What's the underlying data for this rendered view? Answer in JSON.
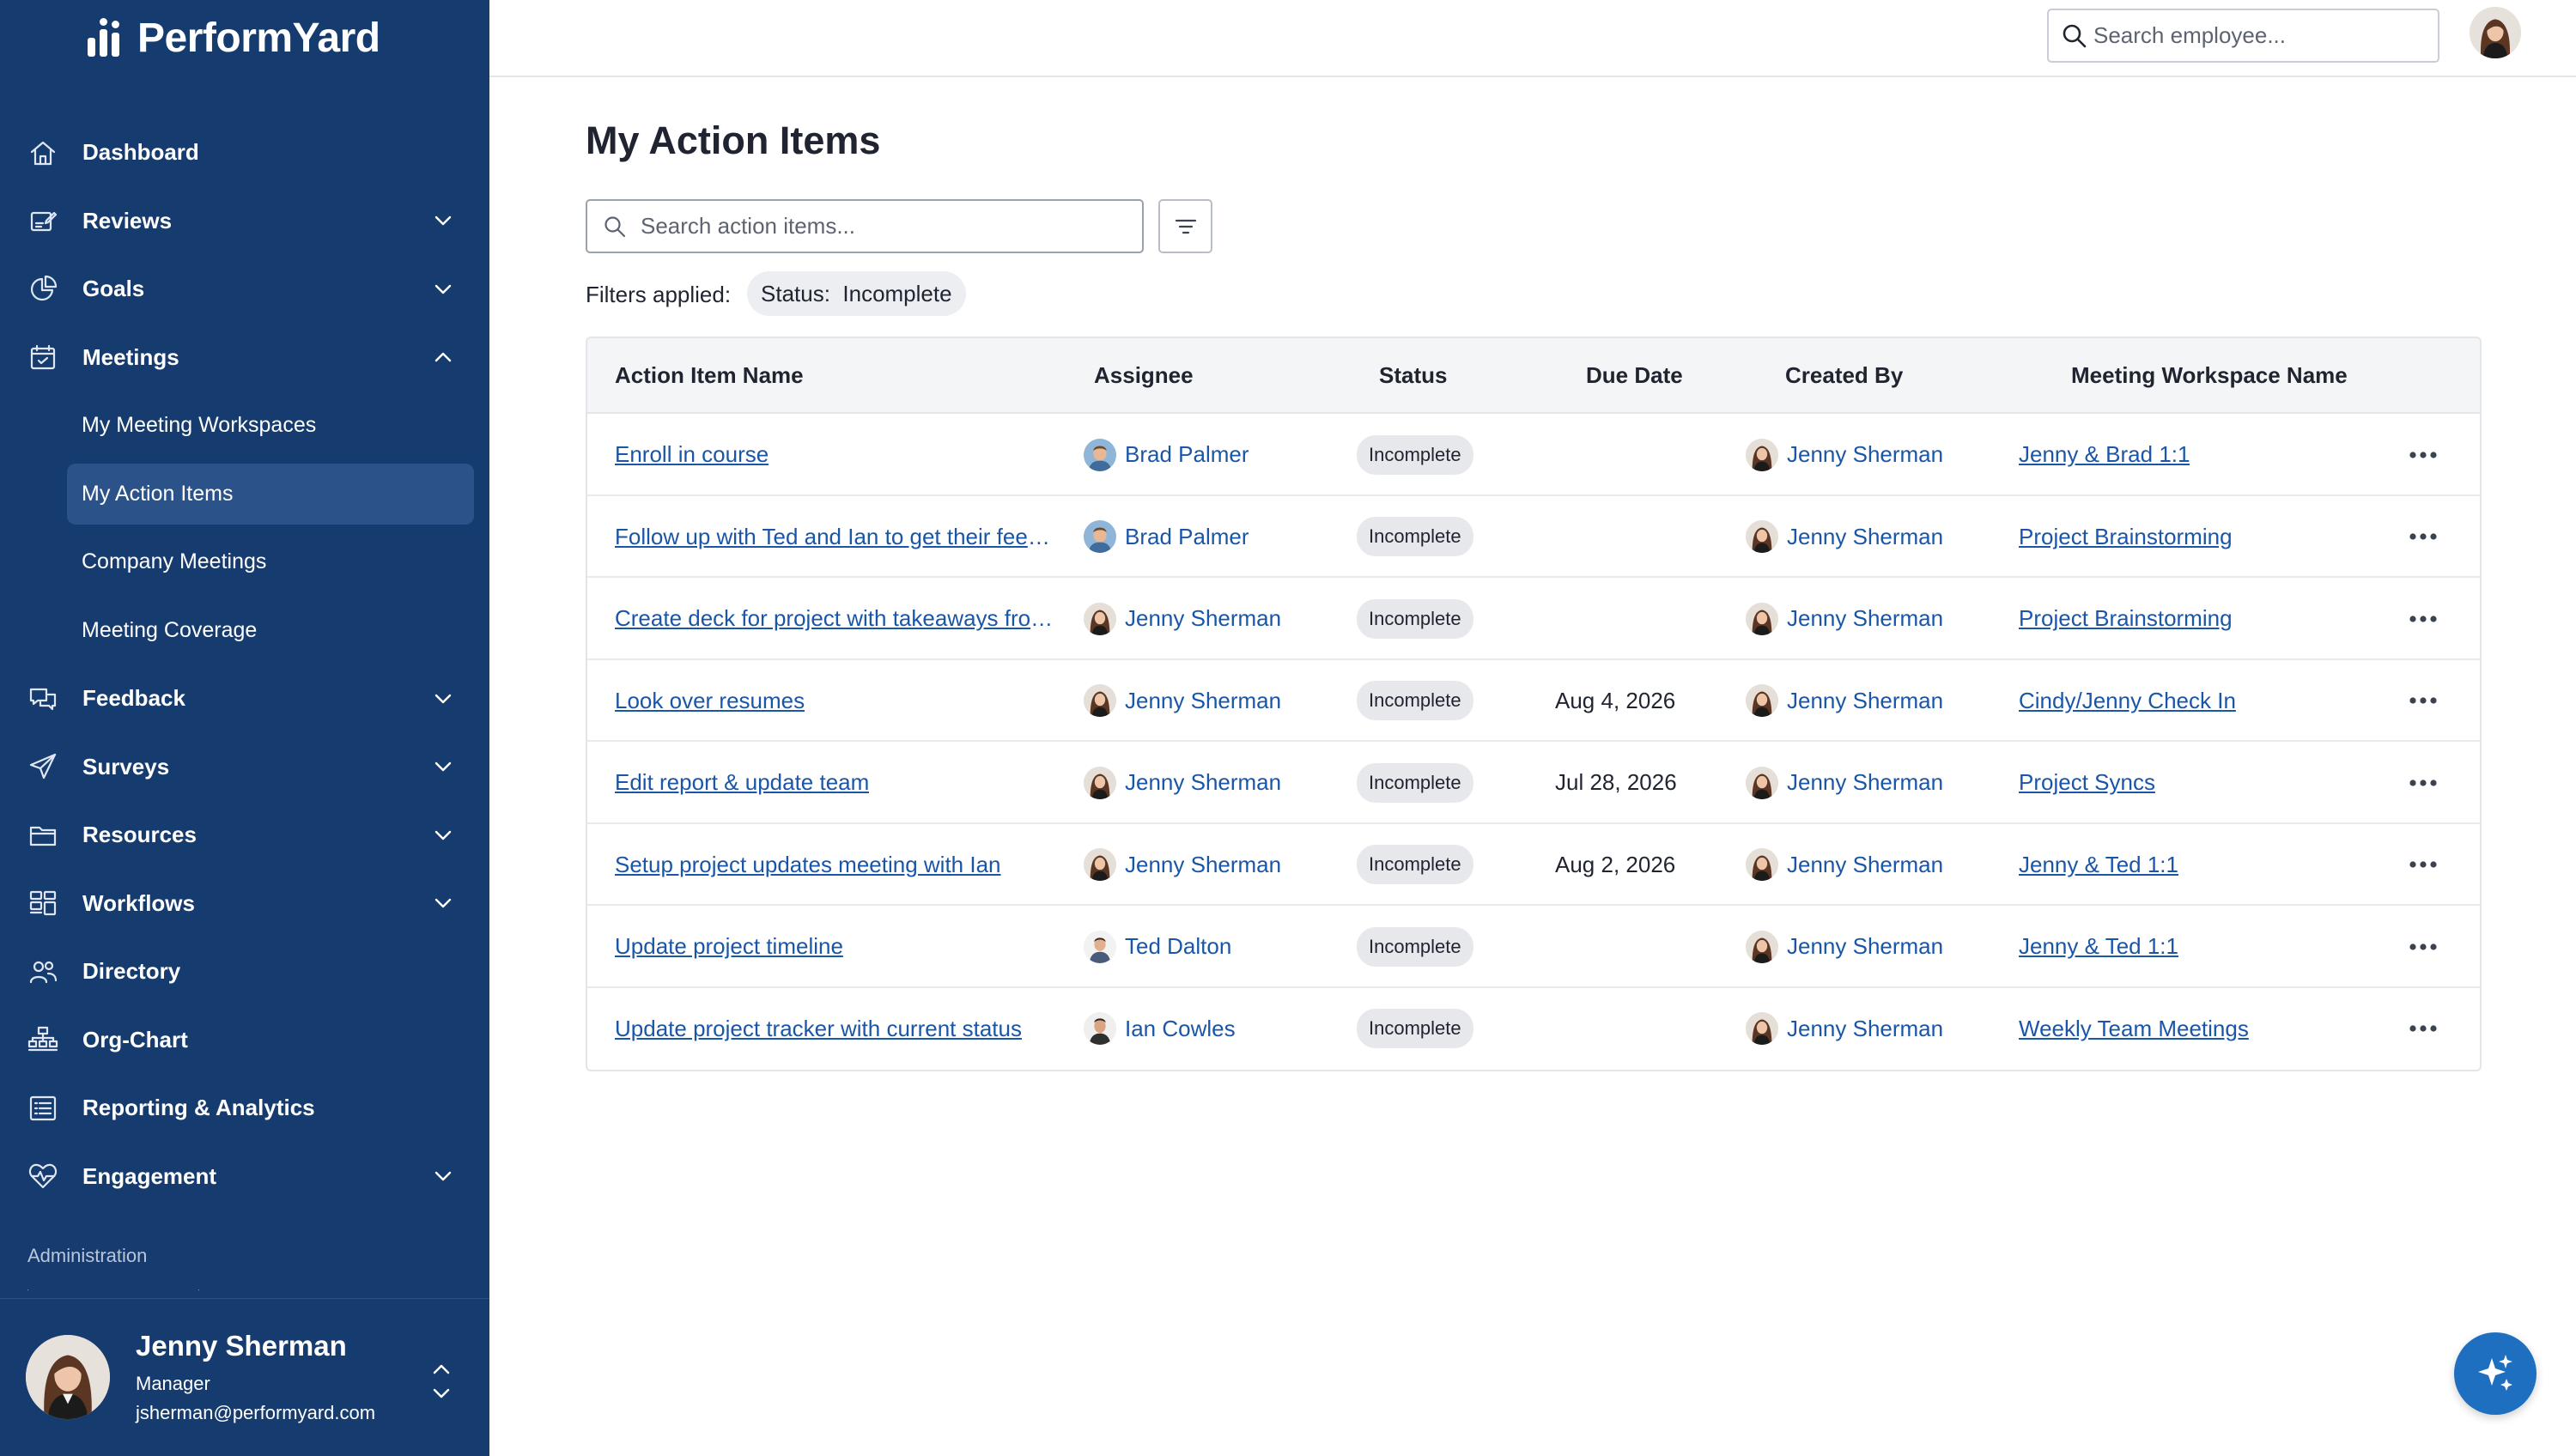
{
  "app": {
    "brand": "PerformYard"
  },
  "topbar": {
    "search_placeholder": "Search employee..."
  },
  "sidebar": {
    "items": [
      {
        "label": "Dashboard",
        "icon": "home-icon",
        "has_chevron": false
      },
      {
        "label": "Reviews",
        "icon": "reviews-icon",
        "has_chevron": true
      },
      {
        "label": "Goals",
        "icon": "pie-chart-icon",
        "has_chevron": true
      },
      {
        "label": "Meetings",
        "icon": "calendar-icon",
        "has_chevron": true,
        "expanded": true
      }
    ],
    "meetings_sub": [
      {
        "label": "My Meeting Workspaces",
        "active": false
      },
      {
        "label": "My Action Items",
        "active": true
      },
      {
        "label": "Company Meetings",
        "active": false
      },
      {
        "label": "Meeting Coverage",
        "active": false
      }
    ],
    "items_after": [
      {
        "label": "Feedback",
        "icon": "chat-bubbles-icon",
        "has_chevron": true
      },
      {
        "label": "Surveys",
        "icon": "paper-plane-icon",
        "has_chevron": true
      },
      {
        "label": "Resources",
        "icon": "folder-icon",
        "has_chevron": true
      },
      {
        "label": "Workflows",
        "icon": "workflow-icon",
        "has_chevron": true
      },
      {
        "label": "Directory",
        "icon": "people-icon",
        "has_chevron": false
      },
      {
        "label": "Org-Chart",
        "icon": "org-chart-icon",
        "has_chevron": false
      },
      {
        "label": "Reporting & Analytics",
        "icon": "report-list-icon",
        "has_chevron": false
      },
      {
        "label": "Engagement",
        "icon": "heart-pulse-icon",
        "has_chevron": true
      }
    ],
    "admin_label": "Administration"
  },
  "profile": {
    "name": "Jenny Sherman",
    "role": "Manager",
    "email": "jsherman@performyard.com"
  },
  "main": {
    "title": "My Action Items",
    "search_placeholder": "Search action items...",
    "filters_label": "Filters applied:",
    "filter_chip": "Status:  Incomplete",
    "columns": [
      "Action Item Name",
      "Assignee",
      "Status",
      "Due Date",
      "Created By",
      "Meeting Workspace Name"
    ],
    "rows": [
      {
        "name": "Enroll in course",
        "assignee": "Brad Palmer",
        "assignee_avatar": "brad",
        "status": "Incomplete",
        "due": "",
        "created_by": "Jenny Sherman",
        "workspace": "Jenny & Brad 1:1"
      },
      {
        "name": "Follow up with Ted and Ian to get their feedback",
        "assignee": "Brad Palmer",
        "assignee_avatar": "brad",
        "status": "Incomplete",
        "due": "",
        "created_by": "Jenny Sherman",
        "workspace": "Project Brainstorming"
      },
      {
        "name": "Create deck for project with takeaways from meeting",
        "assignee": "Jenny Sherman",
        "assignee_avatar": "jenny",
        "status": "Incomplete",
        "due": "",
        "created_by": "Jenny Sherman",
        "workspace": "Project Brainstorming"
      },
      {
        "name": "Look over resumes",
        "assignee": "Jenny Sherman",
        "assignee_avatar": "jenny",
        "status": "Incomplete",
        "due": "Aug 4, 2026",
        "created_by": "Jenny Sherman",
        "workspace": "Cindy/Jenny Check In"
      },
      {
        "name": "Edit report & update team",
        "assignee": "Jenny Sherman",
        "assignee_avatar": "jenny",
        "status": "Incomplete",
        "due": "Jul 28, 2026",
        "created_by": "Jenny Sherman",
        "workspace": "Project Syncs"
      },
      {
        "name": "Setup project updates meeting with Ian",
        "assignee": "Jenny Sherman",
        "assignee_avatar": "jenny",
        "status": "Incomplete",
        "due": "Aug 2, 2026",
        "created_by": "Jenny Sherman",
        "workspace": "Jenny & Ted 1:1"
      },
      {
        "name": "Update project timeline",
        "assignee": "Ted Dalton",
        "assignee_avatar": "ted",
        "status": "Incomplete",
        "due": "",
        "created_by": "Jenny Sherman",
        "workspace": "Jenny & Ted 1:1"
      },
      {
        "name": "Update project tracker with current status",
        "assignee": "Ian Cowles",
        "assignee_avatar": "ian",
        "status": "Incomplete",
        "due": "",
        "created_by": "Jenny Sherman",
        "workspace": "Weekly Team Meetings"
      }
    ]
  },
  "colors": {
    "sidebar": "#163b6e",
    "sidebar_active": "#2b5389",
    "link": "#1a56a8",
    "fab": "#1f6fc0"
  }
}
